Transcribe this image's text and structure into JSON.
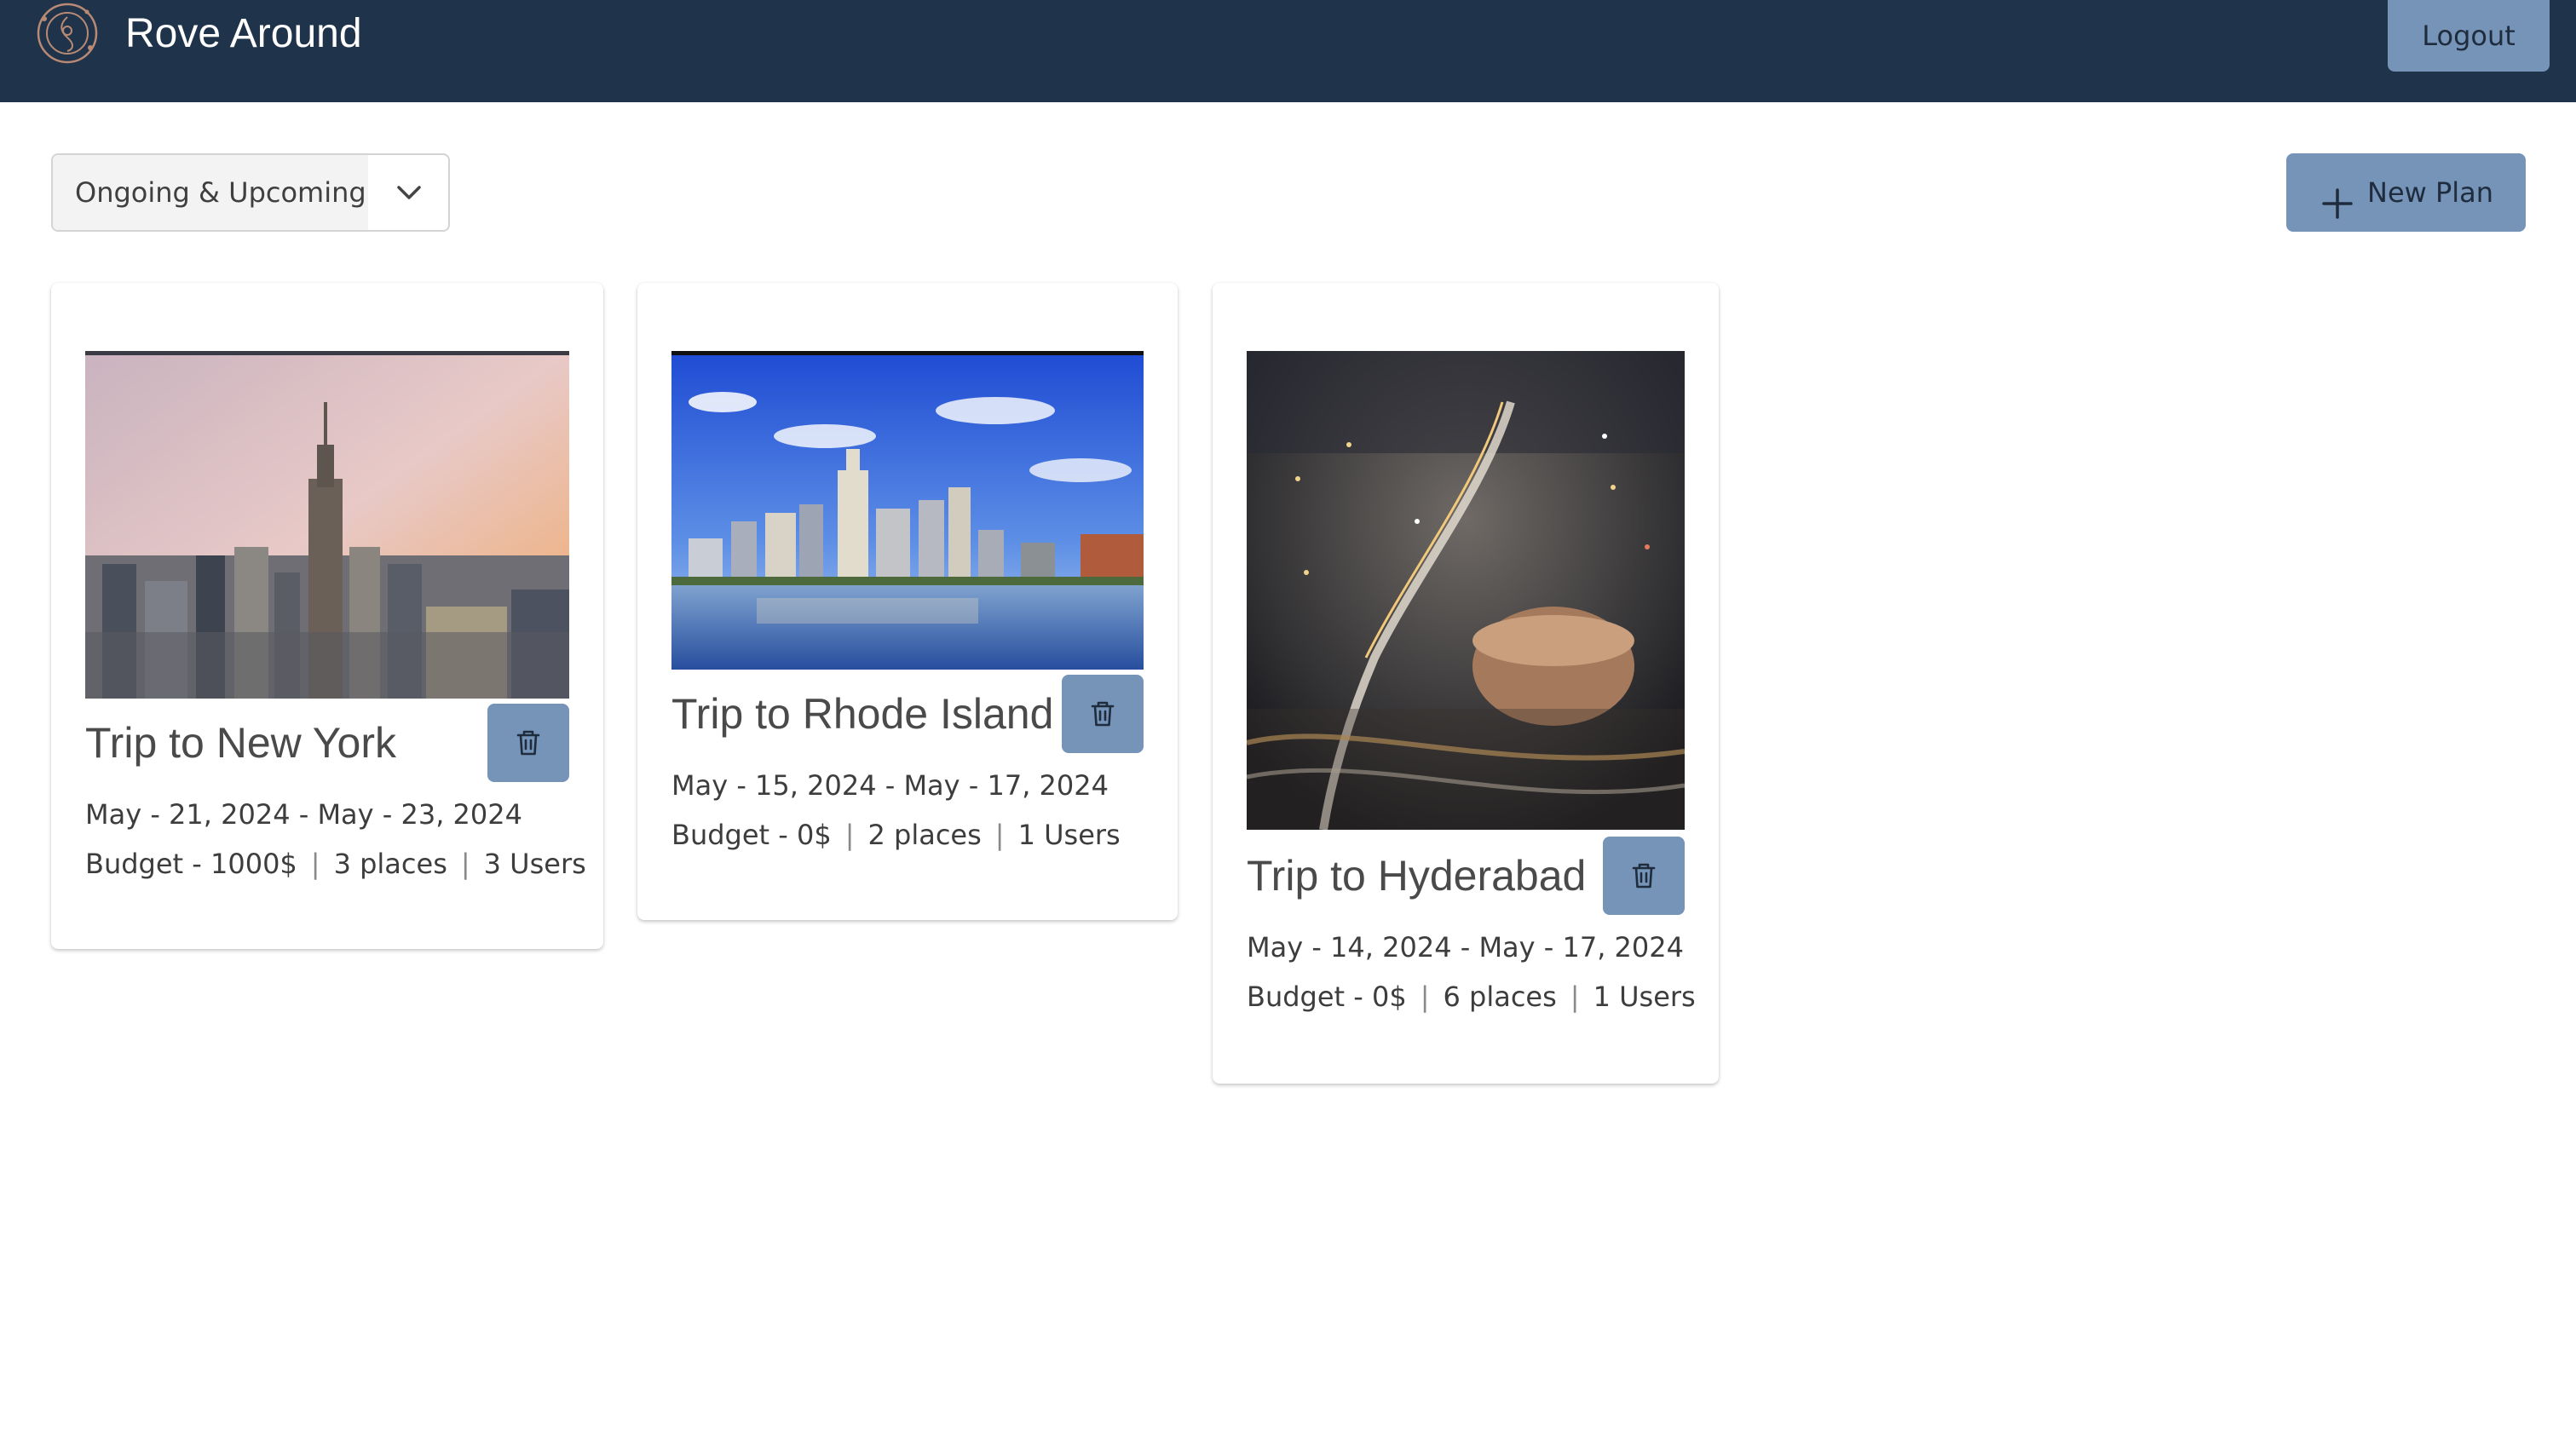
{
  "header": {
    "app_title": "Rove Around",
    "logout_label": "Logout",
    "logo_icon": "compass-logo-icon"
  },
  "toolbar": {
    "filter_value": "Ongoing & Upcoming",
    "new_plan_label": "New Plan"
  },
  "colors": {
    "header_bg": "#1f334b",
    "accent": "#7594b8"
  },
  "trips": [
    {
      "title": "Trip to New York",
      "dates": "May - 21, 2024 - May - 23, 2024",
      "budget": "Budget - 1000$",
      "places": "3 places",
      "users": "3 Users",
      "image": "new-york-skyline-photo"
    },
    {
      "title": "Trip to Rhode Island",
      "dates": "May - 15, 2024 - May - 17, 2024",
      "budget": "Budget - 0$",
      "places": "2 places",
      "users": "1 Users",
      "image": "providence-waterfront-photo"
    },
    {
      "title": "Trip to Hyderabad",
      "dates": "May - 14, 2024 - May - 17, 2024",
      "budget": "Budget - 0$",
      "places": "6 places",
      "users": "1 Users",
      "image": "hyderabad-night-aerial-photo"
    }
  ]
}
